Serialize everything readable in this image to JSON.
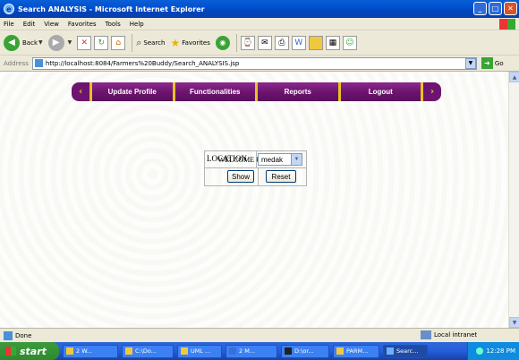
{
  "window": {
    "title": "Search ANALYSIS - Microsoft Internet Explorer",
    "minimize": "_",
    "maximize": "□",
    "close": "✕"
  },
  "menu": [
    "File",
    "Edit",
    "View",
    "Favorites",
    "Tools",
    "Help"
  ],
  "toolbar": {
    "back_label": "Back",
    "search_label": "Search",
    "favorites_label": "Favorites"
  },
  "address": {
    "label": "Address",
    "url": "http://localhost:8084/Farmers%20Buddy/Search_ANALYSIS.jsp",
    "go_label": "Go"
  },
  "nav": {
    "items": [
      "Update Profile",
      "Functionalities",
      "Reports",
      "Logout"
    ]
  },
  "page": {
    "welcome": "WELCOME UserName1",
    "location_label": "LOCATION",
    "location_value": "medak",
    "show_label": "Show",
    "reset_label": "Reset"
  },
  "status": {
    "text": "Done",
    "zone": "Local intranet"
  },
  "taskbar": {
    "start": "start",
    "tasks": [
      "2 W...",
      "C:\\Do...",
      "UML ...",
      "2 M...",
      "D:\\or...",
      "PARM...",
      "Searc..."
    ],
    "clock": "12:28 PM"
  },
  "colors": {
    "nav_purple": "#6d1470",
    "nav_gold": "#e6c227",
    "titlebar_blue": "#0051d0"
  }
}
